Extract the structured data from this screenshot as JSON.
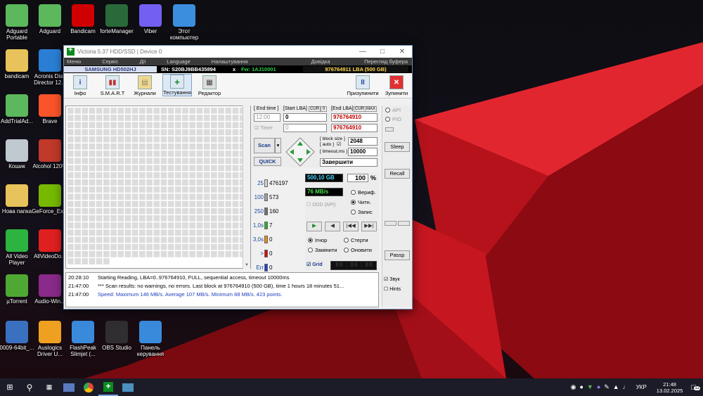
{
  "desktop_icons": [
    {
      "label": "Adguard Portable",
      "icon": "adguard-shield-icon",
      "color": "#5cb85c"
    },
    {
      "label": "Adguard",
      "icon": "adguard-shield-icon",
      "color": "#5cb85c"
    },
    {
      "label": "Bandicam",
      "icon": "bandicam-record-icon",
      "color": "#d00000"
    },
    {
      "label": "forteManager",
      "icon": "forte-manager-icon",
      "color": "#2a6a3a"
    },
    {
      "label": "Viber",
      "icon": "viber-icon",
      "color": "#7360f2"
    },
    {
      "label": "Этот компьютер",
      "icon": "computer-icon",
      "color": "#3b8ede"
    },
    {
      "label": "bandicam",
      "icon": "folder-icon",
      "color": "#e8c25a"
    },
    {
      "label": "Acronis Disk Director 12.5",
      "icon": "acronis-icon",
      "color": "#2a7fd4"
    },
    {
      "label": "AddTrialAd...",
      "icon": "adguard-shield-icon",
      "color": "#5cb85c"
    },
    {
      "label": "Brave",
      "icon": "brave-icon",
      "color": "#fb542b"
    },
    {
      "label": "Кошик",
      "icon": "recycle-bin-icon",
      "color": "#c0c8d0"
    },
    {
      "label": "Alcohol 120%",
      "icon": "alcohol-icon",
      "color": "#c0392b"
    },
    {
      "label": "Нова папка",
      "icon": "folder-icon",
      "color": "#e8c25a"
    },
    {
      "label": "GeForce_Ex...",
      "icon": "geforce-icon",
      "color": "#76b900"
    },
    {
      "label": "All Video Player",
      "icon": "play-icon",
      "color": "#2db340"
    },
    {
      "label": "AllVideoDo...",
      "icon": "download-icon",
      "color": "#e02020"
    },
    {
      "label": "µTorrent",
      "icon": "utorrent-icon",
      "color": "#4ea833"
    },
    {
      "label": "Audio-Win...",
      "icon": "archive-icon",
      "color": "#8a2a8a"
    },
    {
      "label": "0009-64bit_...",
      "icon": "installer-icon",
      "color": "#3a70c0"
    },
    {
      "label": "Auslogics Driver U...",
      "icon": "auslogics-icon",
      "color": "#f0a020"
    },
    {
      "label": "FlashPeak Slimjet (...",
      "icon": "slimjet-icon",
      "color": "#3a8adc"
    },
    {
      "label": "OBS Studio",
      "icon": "obs-icon",
      "color": "#302e31"
    },
    {
      "label": "Панель керування",
      "icon": "control-panel-icon",
      "color": "#3a8adc"
    }
  ],
  "window": {
    "title": "Victoria 5.37 HDD/SSD | Device 0",
    "menu": [
      "Меню",
      "Сервіс",
      "Дії",
      "Language",
      "Налаштування",
      "Довідка"
    ],
    "menu_right": "Перегляд буфера",
    "info": {
      "model": "SAMSUNG HD502HJ",
      "sn": "SN: S20BJ9BB435894",
      "x": "x",
      "fw": "Fw: 1AJ10001",
      "lba": "976764911 LBA (500 GB)"
    },
    "toolbar": {
      "info": "Інфо",
      "smart": "S.M.A.R.T",
      "journals": "Журнали",
      "testing": "Тестування",
      "editor": "Редактор",
      "pause": "Призупинити",
      "stop": "Зупинити"
    },
    "scan": {
      "end_time_label": "[ End time ]",
      "start_lba_label": "[Start LBA]",
      "cur_label": "CUR",
      "zero": "0",
      "end_lba_label": "[End LBA]",
      "max_label": "MAX",
      "end_time": "12:00",
      "timer_label": "Timer",
      "start_lba": "0",
      "timer_value": "0",
      "end_lba": "976764910",
      "cur_lba": "976764910",
      "scan_button": "Scan",
      "quick_button": "QUICK",
      "block_size_label": "[ block size ]",
      "auto_label": "[ auto ]",
      "timeout_label": "[ timeout,ms ]",
      "block_size": "2048",
      "timeout": "10000",
      "finish_action": "Завершити"
    },
    "histogram": [
      {
        "tag": "25",
        "count": "476197",
        "color": "#d0d0d0"
      },
      {
        "tag": "100",
        "count": "573",
        "color": "#a0a0a0"
      },
      {
        "tag": "250",
        "count": "160",
        "color": "#707070"
      },
      {
        "tag": "1,0s",
        "count": "7",
        "color": "#2ab02a"
      },
      {
        "tag": "3,0s",
        "count": "0",
        "color": "#f08a00"
      },
      {
        "tag": ">",
        "count": "0",
        "color": "#e00000"
      },
      {
        "tag": "Err",
        "count": "0",
        "color": "#2040d0"
      }
    ],
    "status": {
      "size": "500,10 GB",
      "percent": "100",
      "percent_sign": "%",
      "speed": "76 MB/s",
      "ddd": "DDD (API)",
      "verify": "Вериф.",
      "read": "Читн.",
      "write": "Запис",
      "ignore": "Ігнор",
      "erase": "Стерти",
      "remap": "Замінити",
      "refresh": "Оновити",
      "grid": "Grid",
      "timer": "00 : 00 : 00"
    },
    "side": {
      "api": "API",
      "pio": "PIO",
      "sleep": "Sleep",
      "recall": "Recall",
      "passp": "Passp",
      "sound": "Звук",
      "hints": "Hints"
    },
    "log": [
      {
        "time": "20:28:10",
        "text": "Starting Reading, LBA=0..976764910, FULL, sequential access, timeout 10000ms",
        "color": "#000"
      },
      {
        "time": "21:47:00",
        "text": "*** Scan results: no warnings, no errors. Last block at 976764910 (500 GB), time 1 hours 18 minutes 51...",
        "color": "#000"
      },
      {
        "time": "21:47:00",
        "text": "Speed: Maximum 146 MB/s. Average 107 MB/s. Minimum 68 MB/s. 423 points.",
        "color": "#1f3fbf"
      }
    ]
  },
  "taskbar": {
    "lang": "УКР",
    "time": "21:48",
    "date": "13.02.2025",
    "notif": "12"
  }
}
